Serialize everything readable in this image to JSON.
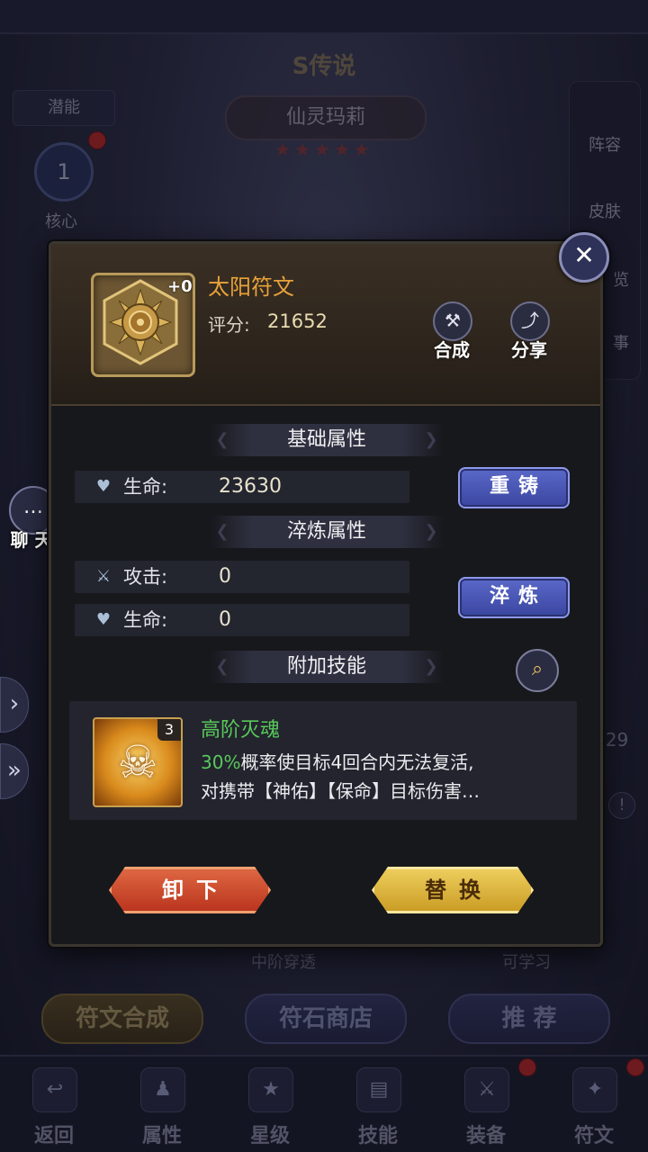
{
  "background": {
    "title": "S传说",
    "hero_name": "仙灵玛莉",
    "stars": "★★★★★",
    "potential": "潜能",
    "core_level": "1",
    "core": "核心",
    "right_items": [
      "阵容",
      "皮肤",
      "览",
      "事"
    ],
    "chat": "聊 天",
    "side_number": "629",
    "under_skill_left": "中阶穿透",
    "under_skill_right": "可学习",
    "buttons": [
      "符文合成",
      "符石商店",
      "推 荐"
    ],
    "tabs": [
      "返回",
      "属性",
      "星级",
      "技能",
      "装备",
      "符文"
    ]
  },
  "dialog": {
    "rune_name": "太阳符文",
    "rune_level": "+0",
    "score_label": "评分:",
    "score_value": "21652",
    "compose": "合成",
    "share": "分享",
    "base_title": "基础属性",
    "base_stat_name": "生命:",
    "base_stat_value": "23630",
    "reforge": "重铸",
    "refine_title": "淬炼属性",
    "refine_attack_name": "攻击:",
    "refine_attack_value": "0",
    "refine_hp_name": "生命:",
    "refine_hp_value": "0",
    "refine": "淬炼",
    "extra_title": "附加技能",
    "skill_level": "3",
    "skill_name": "高阶灭魂",
    "skill_pct": "30%",
    "skill_desc_1": "概率使目标4回合内无法复活,",
    "skill_desc_2": "对携带【神佑】【保命】目标伤害…",
    "unequip": "卸下",
    "replace": "替换"
  },
  "colors": {
    "rune_name": "#e8a23a",
    "skill_green": "#58c85a",
    "blue_button": "#4a56b4",
    "unequip_red": "#c8462a",
    "replace_gold": "#e0b83a"
  }
}
